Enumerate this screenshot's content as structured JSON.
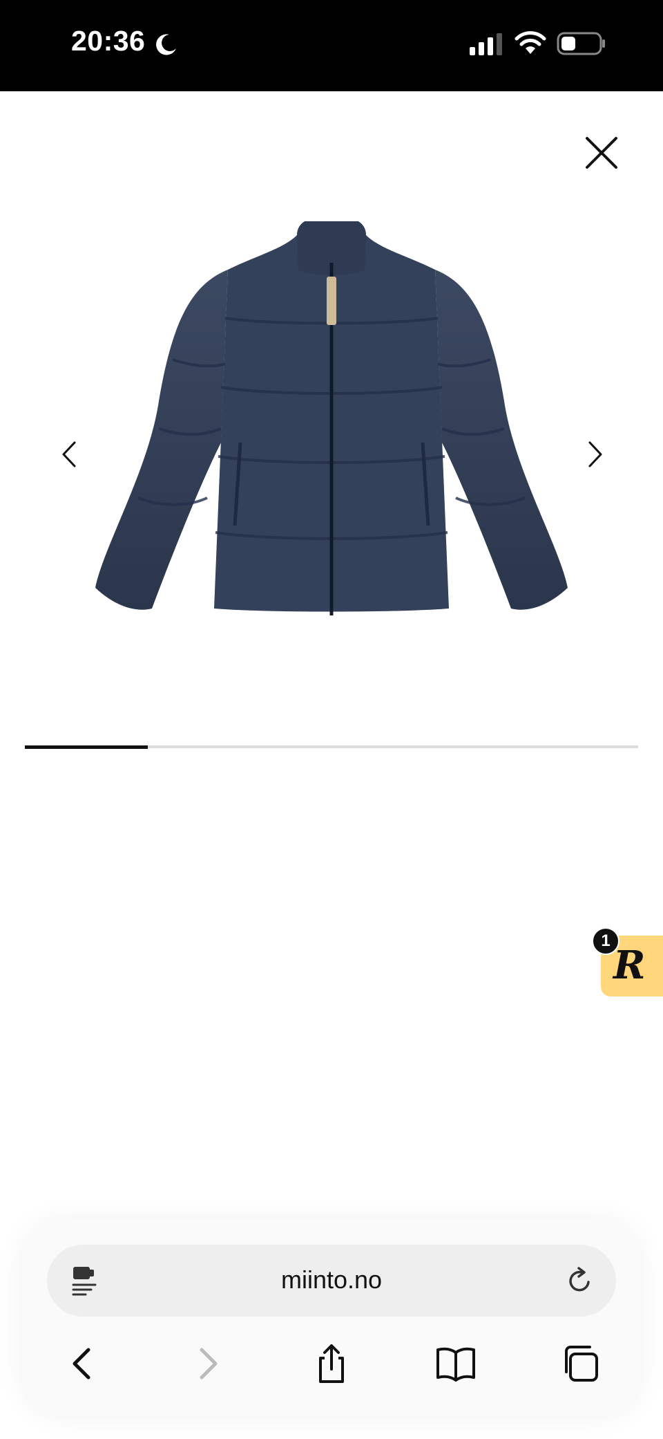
{
  "status_bar": {
    "time": "20:36",
    "icons": [
      "moon-icon",
      "cellular-signal-icon",
      "wifi-icon",
      "battery-icon"
    ]
  },
  "viewer": {
    "close_icon": "close-icon",
    "prev_icon": "chevron-left-icon",
    "next_icon": "chevron-right-icon",
    "image_subject": "navy puffer jacket",
    "image_position_fraction": 0.2
  },
  "reward_widget": {
    "badge_count": "1",
    "logo_text": "R",
    "color": "#ffd77a"
  },
  "browser": {
    "url": "miinto.no",
    "toolbar": [
      "back-icon",
      "forward-icon",
      "share-icon",
      "bookmarks-icon",
      "tabs-icon"
    ]
  }
}
